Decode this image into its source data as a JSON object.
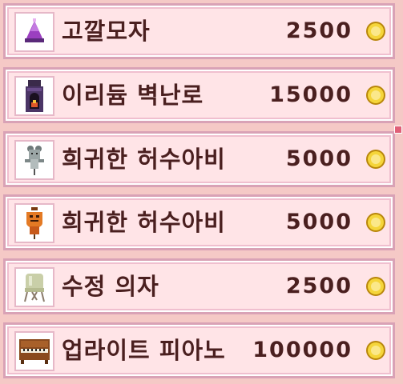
{
  "items": [
    {
      "name": "고깔모자",
      "price": "2500",
      "icon": "party-hat-icon"
    },
    {
      "name": "이리듐 벽난로",
      "price": "15000",
      "icon": "iridium-fireplace-icon"
    },
    {
      "name": "희귀한 허수아비",
      "price": "5000",
      "icon": "rare-scarecrow-gray-icon"
    },
    {
      "name": "희귀한 허수아비",
      "price": "5000",
      "icon": "rare-scarecrow-orange-icon"
    },
    {
      "name": "수정 의자",
      "price": "2500",
      "icon": "crystal-chair-icon"
    },
    {
      "name": "업라이트 피아노",
      "price": "100000",
      "icon": "upright-piano-icon"
    }
  ],
  "currency_icon": "gold-coin-icon",
  "colors": {
    "panel": "#ffe4e7",
    "border": "#d9a2b6",
    "text": "#4a1f1f",
    "coin": "#f5d53a"
  }
}
